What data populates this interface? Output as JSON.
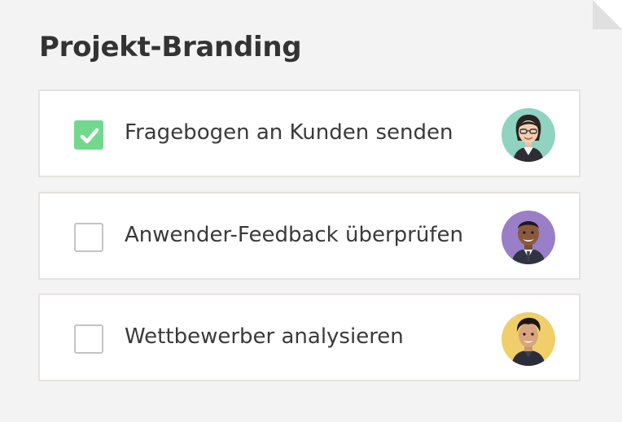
{
  "project": {
    "title": "Projekt-Branding"
  },
  "tasks": [
    {
      "label": "Fragebogen an Kunden senden",
      "checked": true,
      "avatar_color": "#8fd3c0"
    },
    {
      "label": "Anwender-Feedback überprüfen",
      "checked": false,
      "avatar_color": "#9b7ec8"
    },
    {
      "label": "Wettbewerber analysieren",
      "checked": false,
      "avatar_color": "#f0cf6a"
    }
  ],
  "colors": {
    "check_green": "#72d88e",
    "text": "#3a3a3a",
    "card_border": "#e6e2df",
    "background": "#f3f3f3"
  }
}
